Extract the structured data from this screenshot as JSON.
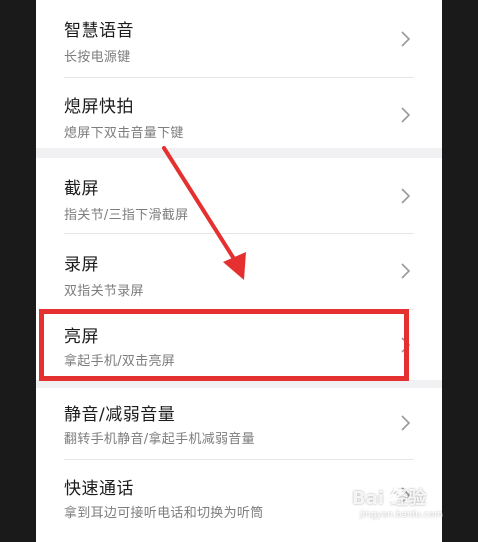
{
  "settings_items": [
    {
      "title": "智慧语音",
      "subtitle": "长按电源键"
    },
    {
      "title": "熄屏快拍",
      "subtitle": "熄屏下双击音量下键"
    },
    {
      "title": "截屏",
      "subtitle": "指关节/三指下滑截屏"
    },
    {
      "title": "录屏",
      "subtitle": "双指关节录屏"
    },
    {
      "title": "亮屏",
      "subtitle": "拿起手机/双击亮屏"
    },
    {
      "title": "静音/减弱音量",
      "subtitle": "翻转手机静音/拿起手机减弱音量"
    },
    {
      "title": "快速通话",
      "subtitle": "拿到耳边可接听电话和切换为听筒"
    }
  ],
  "annotation": {
    "highlight_color": "#e53030"
  },
  "watermark": {
    "brand": "Bai  经验",
    "url": "jingyan.baidu.com"
  },
  "colors": {
    "background": "#f1f1f3",
    "card": "#ffffff",
    "title": "#1c1c1c",
    "subtitle": "#7d7d7d"
  }
}
